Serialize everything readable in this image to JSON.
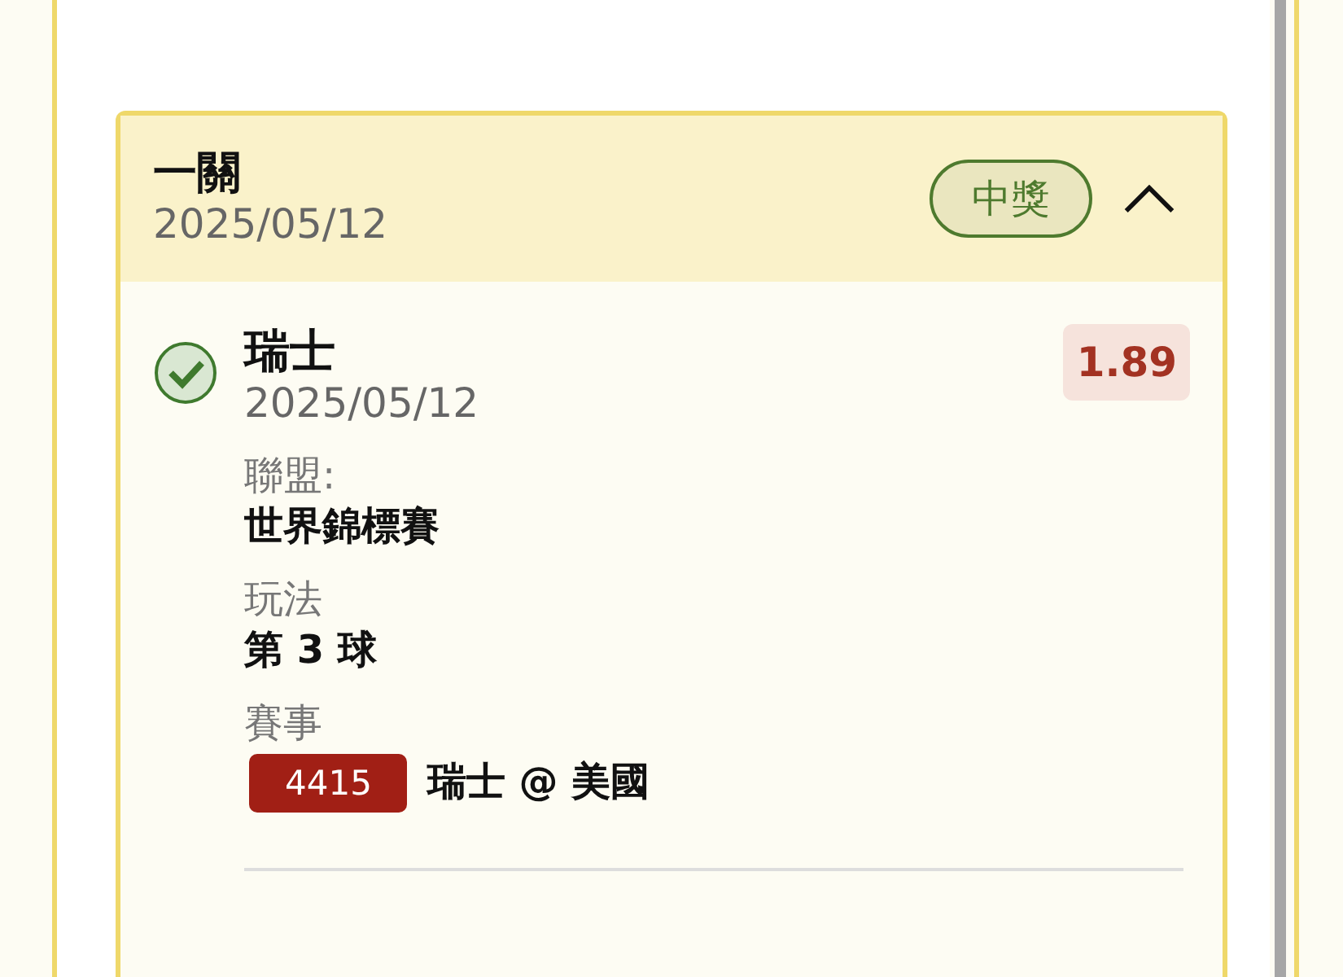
{
  "bet": {
    "title": "一關",
    "date": "2025/05/12",
    "status": "中獎",
    "expanded": true,
    "selections": [
      {
        "name": "瑞士",
        "date": "2025/05/12",
        "won": true,
        "odds": "1.89",
        "fields": [
          {
            "kind": "text",
            "label": "聯盟:",
            "value": "世界錦標賽"
          },
          {
            "kind": "text",
            "label": "玩法",
            "value": "第 3 球"
          },
          {
            "kind": "event",
            "label": "賽事",
            "code": "4415",
            "value": "瑞士 @ 美國"
          }
        ]
      }
    ]
  }
}
